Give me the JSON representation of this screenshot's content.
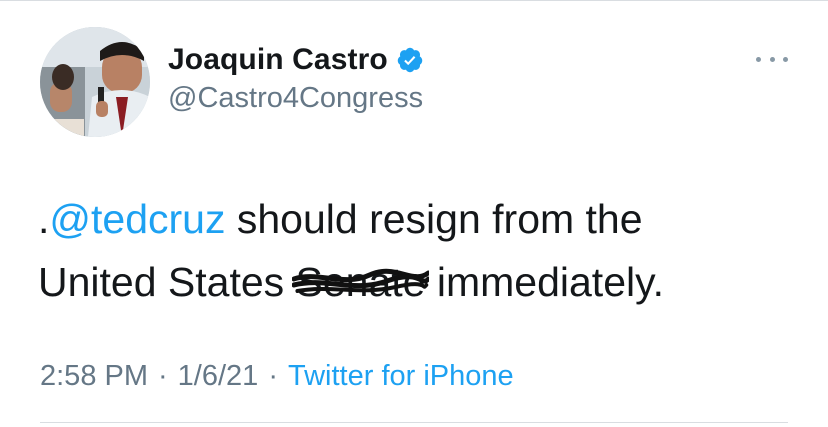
{
  "author": {
    "display_name": "Joaquin Castro",
    "handle": "@Castro4Congress",
    "verified": true,
    "avatar_icon": "profile-photo"
  },
  "tweet": {
    "prefix": ".",
    "mention": "@tedcruz",
    "text_part1": " should resign from the",
    "text_part2": "United States ",
    "struck_word": "Senate",
    "text_part3": " immediately."
  },
  "meta": {
    "time": "2:58 PM",
    "date": "1/6/21",
    "separator": "·",
    "source": "Twitter for iPhone"
  },
  "colors": {
    "link_blue": "#1da1f2",
    "text_dark": "#14171a",
    "text_gray": "#657786"
  },
  "icons": {
    "more": "more-horizontal-icon",
    "verified": "verified-badge-icon"
  }
}
